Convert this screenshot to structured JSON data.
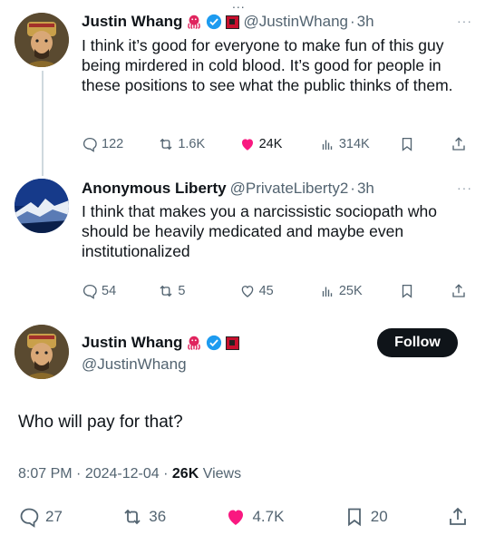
{
  "top_indicator": "...",
  "tweets": [
    {
      "name": "Justin Whang",
      "handle": "@JustinWhang",
      "separator": "·",
      "time": "3h",
      "more": "···",
      "text": "I think it’s good for everyone to make fun of this guy being mirdered in cold blood. It’s good for people in these positions to see what the public thinks of them.",
      "replies": "122",
      "reposts": "1.6K",
      "likes": "24K",
      "views": "314K",
      "liked": true
    },
    {
      "name": "Anonymous Liberty",
      "handle": "@PrivateLiberty2",
      "separator": "·",
      "time": "3h",
      "more": "···",
      "text": "I think that makes you a narcissistic sociopath who should be heavily medicated and maybe even institutionalized",
      "replies": "54",
      "reposts": "5",
      "likes": "45",
      "views": "25K",
      "liked": false
    }
  ],
  "main_tweet": {
    "name": "Justin Whang",
    "handle": "@JustinWhang",
    "follow_label": "Follow",
    "text": "Who will pay for that?",
    "time": "8:07 PM",
    "date": "2024-12-04",
    "views_count": "26K",
    "views_label": "Views",
    "sep": "·",
    "replies": "27",
    "reposts": "36",
    "likes": "4.7K",
    "bookmarks": "20"
  },
  "colors": {
    "like_active": "#f91880",
    "verified": "#1d9bf0",
    "muted": "#536471"
  }
}
